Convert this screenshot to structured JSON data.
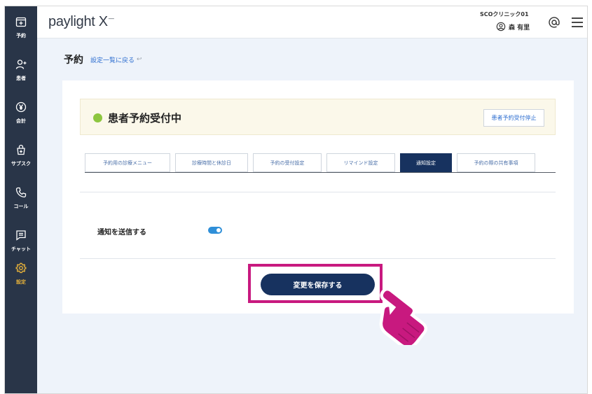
{
  "header": {
    "logo": "paylight X",
    "clinic_name": "SCOクリニック01",
    "user_name": "森 有里"
  },
  "sidebar": {
    "items": [
      {
        "label": "予約",
        "icon": "calendar-plus-icon"
      },
      {
        "label": "患者",
        "icon": "user-add-icon"
      },
      {
        "label": "会計",
        "icon": "yen-circle-icon"
      },
      {
        "label": "サブスク",
        "icon": "subscription-bag-icon"
      },
      {
        "label": "コール",
        "icon": "phone-icon"
      },
      {
        "label": "チャット",
        "icon": "chat-icon"
      },
      {
        "label": "設定",
        "icon": "gear-icon",
        "active": true
      }
    ]
  },
  "page": {
    "title": "予約",
    "back_link": "設定一覧に戻る"
  },
  "status": {
    "text": "患者予約受付中",
    "stop_button": "患者予約受付停止"
  },
  "tabs": [
    {
      "label": "予約用の診療メニュー"
    },
    {
      "label": "診療時間と休診日"
    },
    {
      "label": "予約の受付設定"
    },
    {
      "label": "リマインド設定"
    },
    {
      "label": "通知設定",
      "active": true
    },
    {
      "label": "予約の際の共有事項"
    }
  ],
  "settings": {
    "notify_label": "通知を送信する",
    "notify_enabled": true
  },
  "actions": {
    "save_button": "変更を保存する"
  },
  "colors": {
    "sidebar_bg": "#293548",
    "active_accent": "#e7b23a",
    "primary": "#17325f",
    "link": "#2f6fd0",
    "status_green": "#8dc63f",
    "toggle_on": "#2f8fd8",
    "highlight": "#c8197f"
  }
}
